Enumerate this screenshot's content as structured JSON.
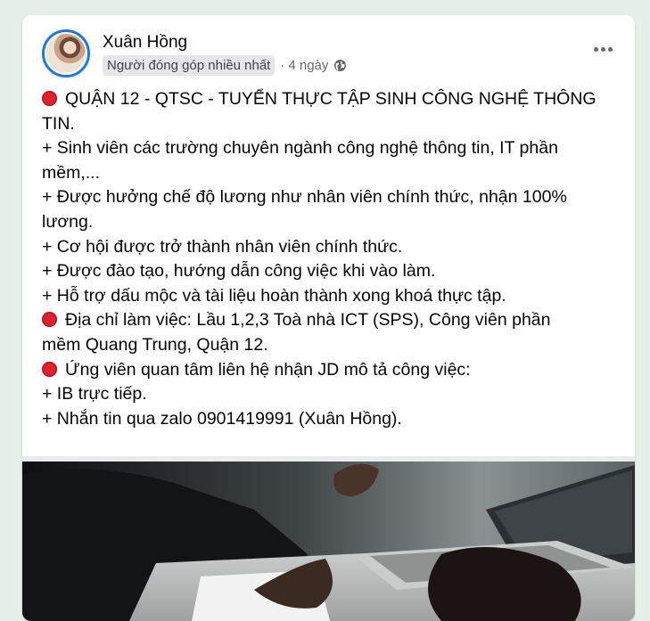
{
  "post": {
    "author": "Xuân Hồng",
    "badge": "Người đóng góp nhiều nhất",
    "separator": "·",
    "time": "4 ngày",
    "privacy_icon": "globe-icon",
    "menu_icon": "more-options-icon",
    "lines": [
      {
        "icon": "stop-sign-icon",
        "text": "QUẬN 12 - QTSC - TUYỂN THỰC TẬP SINH CÔNG NGHỆ THÔNG"
      },
      {
        "text": "TIN."
      },
      {
        "text": "+ Sinh viên các trường chuyên ngành công nghệ thông tin, IT phần"
      },
      {
        "text": "mềm,..."
      },
      {
        "text": "+ Được hưởng chế độ lương như nhân viên chính thức, nhận 100%"
      },
      {
        "text": "lương."
      },
      {
        "text": "+ Cơ hội được trở thành nhân viên chính thức."
      },
      {
        "text": "+ Được đào tạo, hướng dẫn công việc khi vào làm."
      },
      {
        "text": "+ Hỗ trợ dấu mộc và tài liệu hoàn thành xong khoá thực tập."
      },
      {
        "icon": "stop-sign-icon",
        "text": "Địa chỉ làm việc: Lầu 1,2,3 Toà nhà ICT (SPS), Công viên phần"
      },
      {
        "text": "mềm Quang Trung, Quận 12."
      },
      {
        "icon": "stop-sign-icon",
        "text": "Ứng viên quan tâm liên hệ nhận JD mô tả công việc:"
      },
      {
        "text": "+ IB trực tiếp."
      },
      {
        "text": "+ Nhắn tin qua zalo 0901419991 (Xuân Hồng)."
      }
    ]
  },
  "colors": {
    "background": "#e6efe9",
    "card": "#ffffff",
    "avatar_ring": "#1877f2",
    "stop_icon": "#e0202d",
    "secondary_text": "#65676b"
  }
}
